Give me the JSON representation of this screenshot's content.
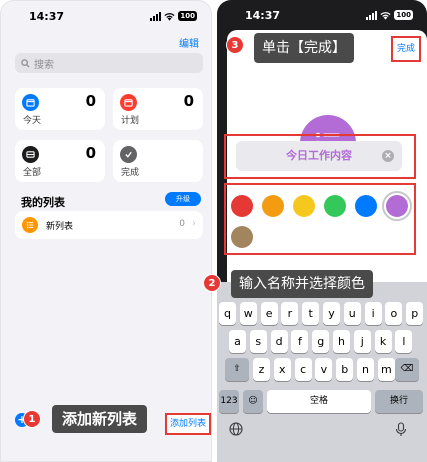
{
  "left_screen": {
    "status_time": "14:37",
    "battery": "100",
    "edit_label": "编辑",
    "search_placeholder": "搜索",
    "cards": [
      {
        "label": "今天",
        "count": "0",
        "color": "#007aff",
        "icon": "calendar-icon"
      },
      {
        "label": "计划",
        "count": "0",
        "color": "#ff3b30",
        "icon": "calendar-icon"
      },
      {
        "label": "全部",
        "count": "0",
        "color": "#1c1c1e",
        "icon": "tray-icon"
      },
      {
        "label": "完成",
        "count": "",
        "color": "#636366",
        "icon": "checkmark-icon"
      }
    ],
    "my_lists_title": "我的列表",
    "upgrade_label": "升级",
    "lists": [
      {
        "name": "新列表",
        "count": "0",
        "color": "#ff9500"
      }
    ],
    "add_list_label": "添加列表"
  },
  "right_screen": {
    "status_time": "14:37",
    "battery": "100",
    "done_label": "完成",
    "list_name_value": "今日工作内容",
    "colors": [
      "#e53935",
      "#f39c12",
      "#f6c71c",
      "#34c759",
      "#007aff",
      "#b36bd6",
      "#a2845e"
    ],
    "selected_color": "#b36bd6",
    "keyboard": {
      "row1": [
        "q",
        "w",
        "e",
        "r",
        "t",
        "y",
        "u",
        "i",
        "o",
        "p"
      ],
      "row2": [
        "a",
        "s",
        "d",
        "f",
        "g",
        "h",
        "j",
        "k",
        "l"
      ],
      "row3": [
        "z",
        "x",
        "c",
        "v",
        "b",
        "n",
        "m"
      ],
      "num_key": "123",
      "space_key": "空格",
      "return_key": "换行"
    }
  },
  "annotations": [
    {
      "step": "1",
      "text": "添加新列表"
    },
    {
      "step": "2",
      "text": "输入名称并选择颜色"
    },
    {
      "step": "3",
      "text": "单击【完成】"
    }
  ]
}
